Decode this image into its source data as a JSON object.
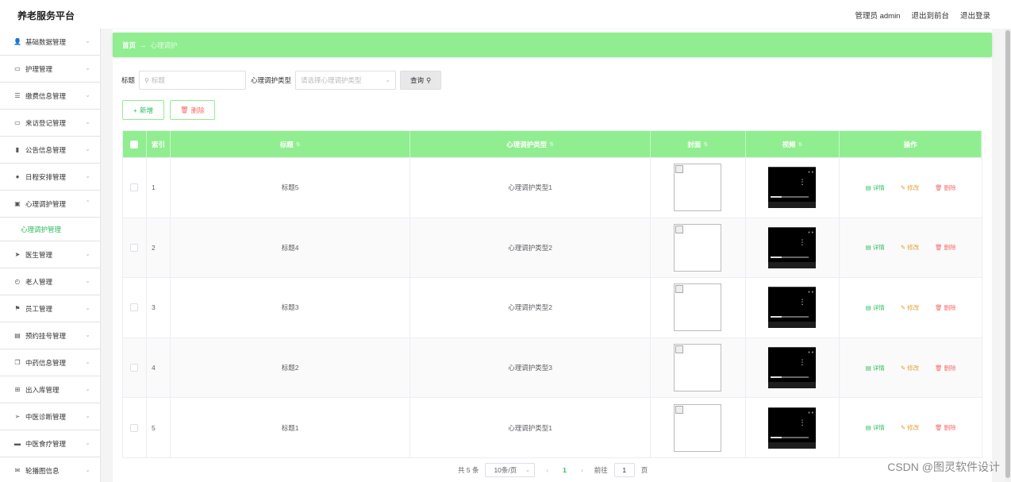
{
  "header": {
    "brand": "养老服务平台",
    "admin_label": "管理员 admin",
    "back_front": "退出到前台",
    "logout": "退出登录"
  },
  "sidebar": {
    "items": [
      {
        "label": "基础数据管理",
        "icon": "user-icon",
        "glyph": "👤"
      },
      {
        "label": "护理管理",
        "icon": "monitor-icon",
        "glyph": "▭"
      },
      {
        "label": "缴费信息管理",
        "icon": "list-icon",
        "glyph": "☰"
      },
      {
        "label": "来访登记管理",
        "icon": "monitor-icon",
        "glyph": "▭"
      },
      {
        "label": "公告信息管理",
        "icon": "chart-icon",
        "glyph": "▮"
      },
      {
        "label": "日程安排管理",
        "icon": "location-icon",
        "glyph": "●"
      },
      {
        "label": "心理调护管理",
        "icon": "clipboard-icon",
        "glyph": "▣"
      },
      {
        "label": "医生管理",
        "icon": "send-icon",
        "glyph": "➤"
      },
      {
        "label": "老人管理",
        "icon": "clock-icon",
        "glyph": "◴"
      },
      {
        "label": "员工管理",
        "icon": "flag-icon",
        "glyph": "⚑"
      },
      {
        "label": "预约挂号管理",
        "icon": "document-icon",
        "glyph": "▤"
      },
      {
        "label": "中药信息管理",
        "icon": "copy-icon",
        "glyph": "❐"
      },
      {
        "label": "出入库管理",
        "icon": "grid-icon",
        "glyph": "⊞"
      },
      {
        "label": "中医诊断管理",
        "icon": "navigation-icon",
        "glyph": "➢"
      },
      {
        "label": "中医食疗管理",
        "icon": "film-icon",
        "glyph": "▬"
      },
      {
        "label": "轮播图信息",
        "icon": "mail-icon",
        "glyph": "✉"
      }
    ],
    "submenu_label": "心理调护管理"
  },
  "breadcrumb": {
    "home": "首页",
    "separator": "→",
    "current": "心理调护"
  },
  "search": {
    "title_label": "标题",
    "title_placeholder": "标题",
    "type_label": "心理调护类型",
    "type_placeholder": "请选择心理调护类型",
    "query_button": "查询"
  },
  "actions": {
    "add": "新增",
    "delete": "删除"
  },
  "table": {
    "headers": {
      "index": "索引",
      "title": "标题",
      "type": "心理调护类型",
      "cover": "封面",
      "video": "视频",
      "ops": "操作"
    },
    "rows": [
      {
        "index": "1",
        "title": "标题5",
        "type": "心理调护类型1"
      },
      {
        "index": "2",
        "title": "标题4",
        "type": "心理调护类型2"
      },
      {
        "index": "3",
        "title": "标题3",
        "type": "心理调护类型2"
      },
      {
        "index": "4",
        "title": "标题2",
        "type": "心理调护类型3"
      },
      {
        "index": "5",
        "title": "标题1",
        "type": "心理调护类型1"
      }
    ],
    "op_labels": {
      "detail": "详情",
      "edit": "修改",
      "remove": "删除"
    }
  },
  "pagination": {
    "total": "共 5 条",
    "page_size": "10条/页",
    "current_page": "1",
    "goto_label": "前往",
    "goto_value": "1",
    "page_suffix": "页"
  },
  "watermark": "CSDN @图灵软件设计",
  "colors": {
    "accent": "#90ee90",
    "accent_text": "#2dbd5b",
    "danger": "#f56c6c",
    "warning": "#e6a23c"
  }
}
